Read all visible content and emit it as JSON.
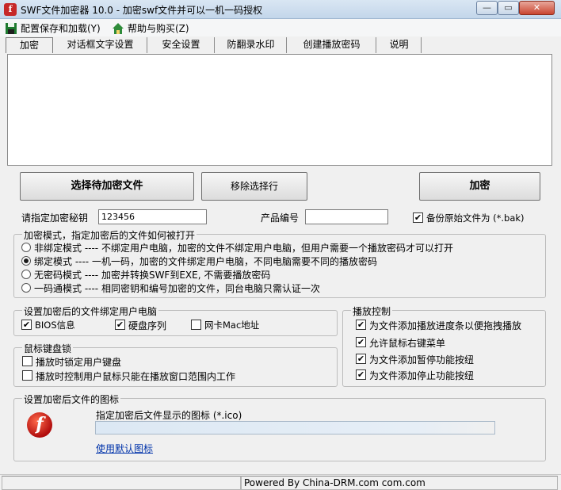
{
  "window": {
    "title": "SWF文件加密器 10.0 - 加密swf文件并可以一机一码授权",
    "app_icon_glyph": "f",
    "min_glyph": "—",
    "max_glyph": "▭",
    "close_glyph": "✕"
  },
  "menu": {
    "config_label": "配置保存和加载(Y)",
    "help_label": "帮助与购买(Z)"
  },
  "tabs": [
    {
      "label": "加密"
    },
    {
      "label": "对话框文字设置"
    },
    {
      "label": "安全设置"
    },
    {
      "label": "防翻录水印"
    },
    {
      "label": "创建播放密码"
    },
    {
      "label": "说明"
    }
  ],
  "buttons": {
    "select_files": "选择待加密文件",
    "remove_selected": "移除选择行",
    "encrypt": "加密"
  },
  "fields": {
    "key_label": "请指定加密秘钥",
    "key_value": "123456",
    "product_label": "产品编号",
    "product_value": "",
    "backup_label": "备份原始文件为 (*.bak)",
    "backup_checked": true
  },
  "mode_group": {
    "title": "加密模式，指定加密后的文件如何被打开",
    "options": [
      {
        "label": "非绑定模式 ---- 不绑定用户电脑，加密的文件不绑定用户电脑，但用户需要一个播放密码才可以打开",
        "selected": false
      },
      {
        "label": "绑定模式 ---- 一机一码，加密的文件绑定用户电脑，不同电脑需要不同的播放密码",
        "selected": true
      },
      {
        "label": "无密码模式 ---- 加密并转换SWF到EXE, 不需要播放密码",
        "selected": false
      },
      {
        "label": "一码通模式 ---- 相同密钥和编号加密的文件，同台电脑只需认证一次",
        "selected": false
      }
    ]
  },
  "bind_group": {
    "title": "设置加密后的文件绑定用户电脑",
    "bios_label": "BIOS信息",
    "bios_checked": true,
    "disk_label": "硬盘序列",
    "disk_checked": true,
    "mac_label": "网卡Mac地址",
    "mac_checked": false
  },
  "lock_group": {
    "title": "鼠标键盘锁",
    "keyboard_label": "播放时锁定用户键盘",
    "keyboard_checked": false,
    "mouse_label": "播放时控制用户鼠标只能在播放窗口范围内工作",
    "mouse_checked": false
  },
  "playback_group": {
    "title": "播放控制",
    "items": [
      {
        "label": "为文件添加播放进度条以便拖拽播放",
        "checked": true
      },
      {
        "label": "允许鼠标右键菜单",
        "checked": true
      },
      {
        "label": "为文件添加暂停功能按纽",
        "checked": true
      },
      {
        "label": "为文件添加停止功能按纽",
        "checked": true
      }
    ]
  },
  "icon_group": {
    "title": "设置加密后文件的图标",
    "hint": "指定加密后文件显示的图标 (*.ico)",
    "path_value": "",
    "default_link": "使用默认图标",
    "icon_glyph": "f"
  },
  "statusbar": {
    "cell1": "",
    "cell2": "Powered By China-DRM.com com.com"
  },
  "colors": {
    "link": "#0033aa",
    "window_bg": "#f0f0f0",
    "titlebar": "#c3d6ea"
  }
}
